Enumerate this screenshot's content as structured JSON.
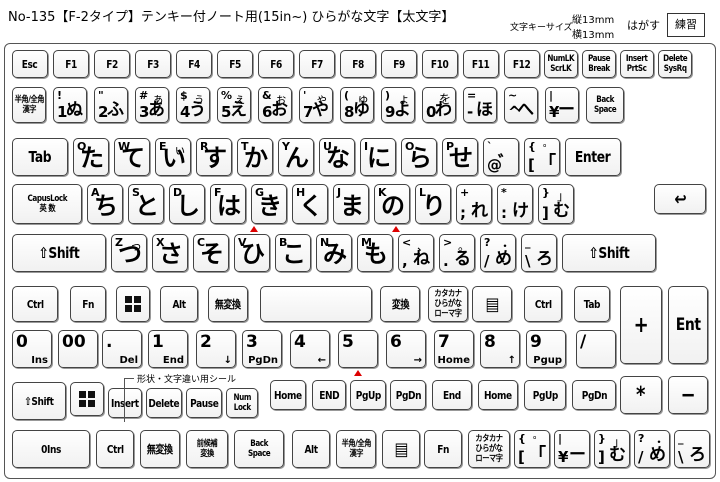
{
  "header": {
    "title": "No-135【F-2タイプ】テンキー付ノート用(15in~) ひらがな文字【太文字】",
    "size_label": "文字キーサイズ",
    "size_h": "縦13mm",
    "size_w": "横13mm",
    "peel": "はがす",
    "practice": "練習"
  },
  "note": "形状・文字違い用シール",
  "rows": {
    "fn": [
      "Esc",
      "F1",
      "F2",
      "F3",
      "F4",
      "F5",
      "F6",
      "F7",
      "F8",
      "F9",
      "F10",
      "F11",
      "F12",
      "NumLK|ScrLK",
      "Pause|Break",
      "Insert|PrtSc",
      "Delete|SysRq"
    ],
    "num": [
      {
        "en": "半角/全角",
        "jp": "漢字",
        "t": "sm"
      },
      {
        "en": "!",
        "b": "1",
        "k": "ぬ"
      },
      {
        "en": "\"",
        "b": "2",
        "k": "ふ"
      },
      {
        "en": "#",
        "b": "3",
        "k": "あ",
        "k2": "ぁ"
      },
      {
        "en": "$",
        "b": "4",
        "k": "う",
        "k2": "ぅ"
      },
      {
        "en": "%",
        "b": "5",
        "k": "え",
        "k2": "ぇ"
      },
      {
        "en": "&",
        "b": "6",
        "k": "お",
        "k2": "ぉ"
      },
      {
        "en": "'",
        "b": "7",
        "k": "や",
        "k2": "ゃ"
      },
      {
        "en": "(",
        "b": "8",
        "k": "ゆ",
        "k2": "ゅ"
      },
      {
        "en": ")",
        "b": "9",
        "k": "よ",
        "k2": "ょ"
      },
      {
        "en": "",
        "b": "0",
        "k": "わ",
        "k2": "を"
      },
      {
        "en": "=",
        "b": "-",
        "k": "ほ"
      },
      {
        "en": "~",
        "b": "^",
        "k": "へ"
      },
      {
        "en": "|",
        "b": "¥",
        "k": "ー"
      },
      {
        "en": "Back",
        "b": "Space",
        "t": "sm"
      }
    ],
    "q": [
      {
        "l": "Tab"
      },
      {
        "en": "Q",
        "k": "た"
      },
      {
        "en": "W",
        "k": "て"
      },
      {
        "en": "E",
        "k": "い",
        "k2": "ぃ"
      },
      {
        "en": "R",
        "k": "す"
      },
      {
        "en": "T",
        "k": "か"
      },
      {
        "en": "Y",
        "k": "ん"
      },
      {
        "en": "U",
        "k": "な"
      },
      {
        "en": "I",
        "k": "に"
      },
      {
        "en": "O",
        "k": "ら"
      },
      {
        "en": "P",
        "k": "せ"
      },
      {
        "en": "`",
        "b": "@",
        "k": "゛"
      },
      {
        "en": "{",
        "b": "[",
        "k": "「",
        "k2": "゜"
      },
      {
        "l": "Enter"
      }
    ],
    "a": [
      {
        "l": "CapusLock",
        "l2": "英 数"
      },
      {
        "en": "A",
        "k": "ち"
      },
      {
        "en": "S",
        "k": "と"
      },
      {
        "en": "D",
        "k": "し"
      },
      {
        "en": "F",
        "k": "は"
      },
      {
        "en": "G",
        "k": "き"
      },
      {
        "en": "H",
        "k": "く"
      },
      {
        "en": "J",
        "k": "ま"
      },
      {
        "en": "K",
        "k": "の"
      },
      {
        "en": "L",
        "k": "り"
      },
      {
        "en": "+",
        "b": ";",
        "k": "れ"
      },
      {
        "en": "*",
        "b": ":",
        "k": "け"
      },
      {
        "en": "}",
        "b": "]",
        "k": "む",
        "k2": "」"
      }
    ],
    "z": [
      {
        "l": "⇧Shift"
      },
      {
        "en": "Z",
        "k": "つ",
        "k2": "っ"
      },
      {
        "en": "X",
        "k": "さ"
      },
      {
        "en": "C",
        "k": "そ"
      },
      {
        "en": "V",
        "k": "ひ"
      },
      {
        "en": "B",
        "k": "こ"
      },
      {
        "en": "N",
        "k": "み"
      },
      {
        "en": "M",
        "k": "も"
      },
      {
        "en": "<",
        "b": ",",
        "k": "ね",
        "k2": "、"
      },
      {
        "en": ">",
        "b": ".",
        "k": "る",
        "k2": "。"
      },
      {
        "en": "?",
        "b": "/",
        "k": "め",
        "k2": "・"
      },
      {
        "en": "_",
        "b": "\\",
        "k": "ろ"
      },
      {
        "l": "⇧Shift"
      }
    ],
    "bottom": [
      "Ctrl",
      "Fn",
      "",
      "Alt",
      "無変換",
      "",
      "変換",
      "カタカナ|ひらがな|ローマ字",
      "",
      "Ctrl",
      "Tab"
    ],
    "numpad1": [
      {
        "top": "0",
        "bot": "Ins"
      },
      {
        "top": "00",
        "bot": ""
      },
      {
        "top": ".",
        "bot": "Del"
      },
      {
        "top": "1",
        "bot": "End"
      },
      {
        "top": "2",
        "bot": "↓"
      },
      {
        "top": "3",
        "bot": "PgDn"
      },
      {
        "top": "4",
        "bot": "←"
      },
      {
        "top": "5",
        "bot": ""
      },
      {
        "top": "6",
        "bot": "→"
      },
      {
        "top": "7",
        "bot": "Home"
      },
      {
        "top": "8",
        "bot": "↑"
      },
      {
        "top": "9",
        "bot": "Pgup"
      },
      {
        "top": "/",
        "bot": ""
      }
    ],
    "row6": [
      "⇧Shift",
      "",
      "Insert",
      "Delete",
      "Pause",
      "Num|Lock",
      "Home",
      "END",
      "PgUp",
      "PgDn",
      "End",
      "Home",
      "PgUp",
      "PgDn"
    ],
    "row7": [
      "0Ins",
      "Ctrl",
      "無変換",
      "前候補|変換",
      "Back|Space",
      "Alt",
      "半角/全角|漢字",
      "",
      "Fn",
      "カタカナ|ひらがな|ローマ字"
    ],
    "row7b": [
      {
        "en": "{",
        "b": "[",
        "k": "「",
        "k2": "゜"
      },
      {
        "en": "|",
        "b": "¥",
        "k": "ー"
      },
      {
        "en": "}",
        "b": "]",
        "k": "む",
        "k2": "」"
      },
      {
        "en": "?",
        "b": "/",
        "k": "め",
        "k2": "・"
      },
      {
        "en": "_",
        "b": "\\",
        "k": "ろ"
      }
    ],
    "pad": [
      "+",
      "Ent",
      "*",
      "−"
    ]
  }
}
